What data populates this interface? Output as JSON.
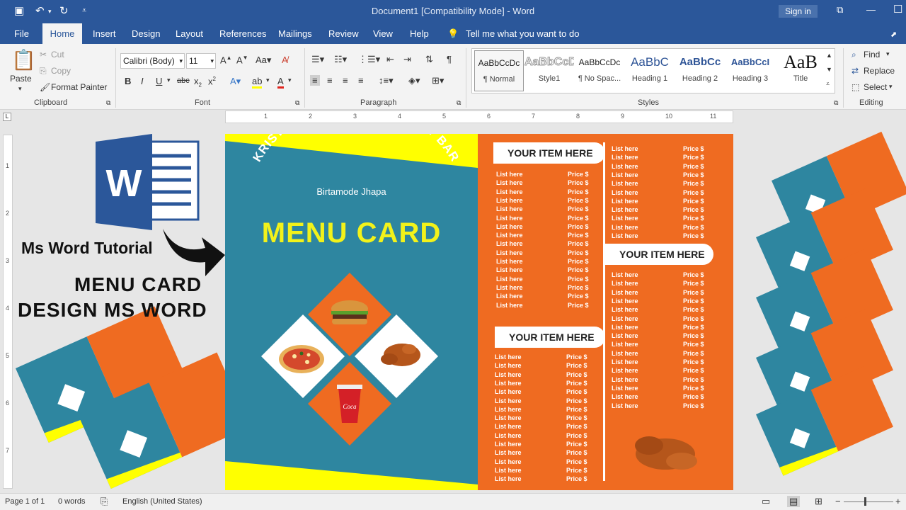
{
  "window": {
    "title": "Document1 [Compatibility Mode] - Word",
    "signin": "Sign in"
  },
  "tabs": [
    "File",
    "Home",
    "Insert",
    "Design",
    "Layout",
    "References",
    "Mailings",
    "Review",
    "View",
    "Help"
  ],
  "tellme": "Tell me what you want to do",
  "clipboard": {
    "paste": "Paste",
    "cut": "Cut",
    "copy": "Copy",
    "format_painter": "Format Painter",
    "label": "Clipboard"
  },
  "font": {
    "name": "Calibri (Body)",
    "size": "11",
    "label": "Font"
  },
  "paragraph": {
    "label": "Paragraph"
  },
  "styles": {
    "label": "Styles",
    "items": [
      {
        "preview": "AaBbCcDc",
        "name": "¶ Normal"
      },
      {
        "preview": "AaBbCcDc",
        "name": "Style1"
      },
      {
        "preview": "AaBbCcDc",
        "name": "¶ No Spac..."
      },
      {
        "preview": "AaBbC",
        "name": "Heading 1"
      },
      {
        "preview": "AaBbCc",
        "name": "Heading 2"
      },
      {
        "preview": "AaBbCcI",
        "name": "Heading 3"
      },
      {
        "preview": "AaB",
        "name": "Title"
      }
    ]
  },
  "editing": {
    "find": "Find",
    "replace": "Replace",
    "select": "Select",
    "label": "Editing"
  },
  "ruler_numbers": [
    "1",
    "2",
    "3",
    "4",
    "5",
    "6",
    "7",
    "8",
    "9",
    "10",
    "11"
  ],
  "vruler_numbers": [
    "1",
    "2",
    "3",
    "4",
    "5",
    "6",
    "7"
  ],
  "overlay": {
    "tutorial": "Ms Word Tutorial",
    "line1": "MENU CARD",
    "line2": "DESIGN MS WORD"
  },
  "menu": {
    "hotel": "KRISTAL HOTEL & RESTURANT BAR",
    "location": "Birtamode Jhapa",
    "title": "MENU CARD",
    "section_title": "YOUR ITEM HERE",
    "item_label": "List here",
    "price_label": "Price $"
  },
  "status": {
    "page": "Page 1 of 1",
    "words": "0 words",
    "language": "English (United States)"
  },
  "colors": {
    "word_blue": "#2b579a",
    "teal": "#2e86a0",
    "orange": "#ef6b21",
    "yellow": "#ffff00"
  }
}
